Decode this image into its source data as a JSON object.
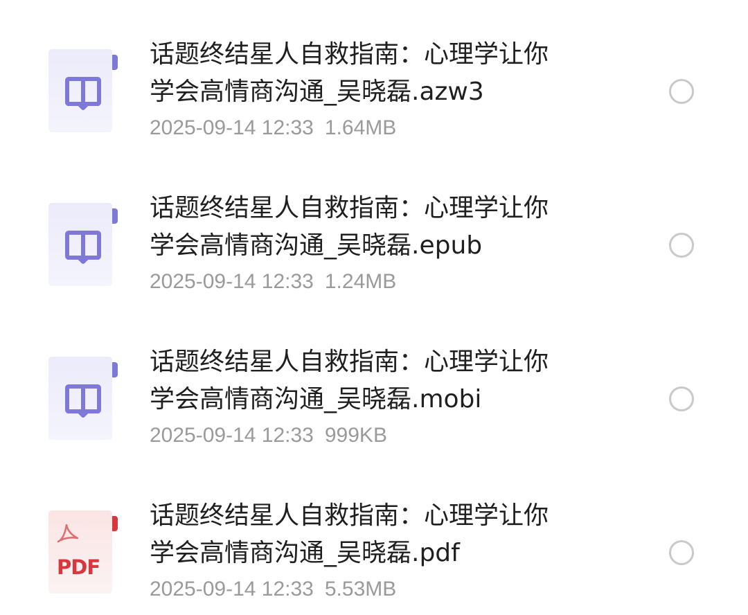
{
  "files": [
    {
      "type": "book",
      "icon": "ebook-icon",
      "name_line1": "话题终结星人自救指南：心理学让你",
      "name_line2": "学会高情商沟通_吴晓磊.azw3",
      "date": "2025-09-14 12:33",
      "size": "1.64MB",
      "selected": false
    },
    {
      "type": "book",
      "icon": "ebook-icon",
      "name_line1": "话题终结星人自救指南：心理学让你",
      "name_line2": "学会高情商沟通_吴晓磊.epub",
      "date": "2025-09-14 12:33",
      "size": "1.24MB",
      "selected": false
    },
    {
      "type": "book",
      "icon": "ebook-icon",
      "name_line1": "话题终结星人自救指南：心理学让你",
      "name_line2": "学会高情商沟通_吴晓磊.mobi",
      "date": "2025-09-14 12:33",
      "size": "999KB",
      "selected": false
    },
    {
      "type": "pdf",
      "icon": "pdf-icon",
      "icon_label": "PDF",
      "name_line1": "话题终结星人自救指南：心理学让你",
      "name_line2": "学会高情商沟通_吴晓磊.pdf",
      "date": "2025-09-14 12:33",
      "size": "5.53MB",
      "selected": false
    }
  ],
  "colors": {
    "book_accent": "#7e78d6",
    "pdf_accent": "#d9363e",
    "name_text": "#1f1f1f",
    "meta_text": "#9a9a9a",
    "radio_border": "#c9c9c9"
  }
}
